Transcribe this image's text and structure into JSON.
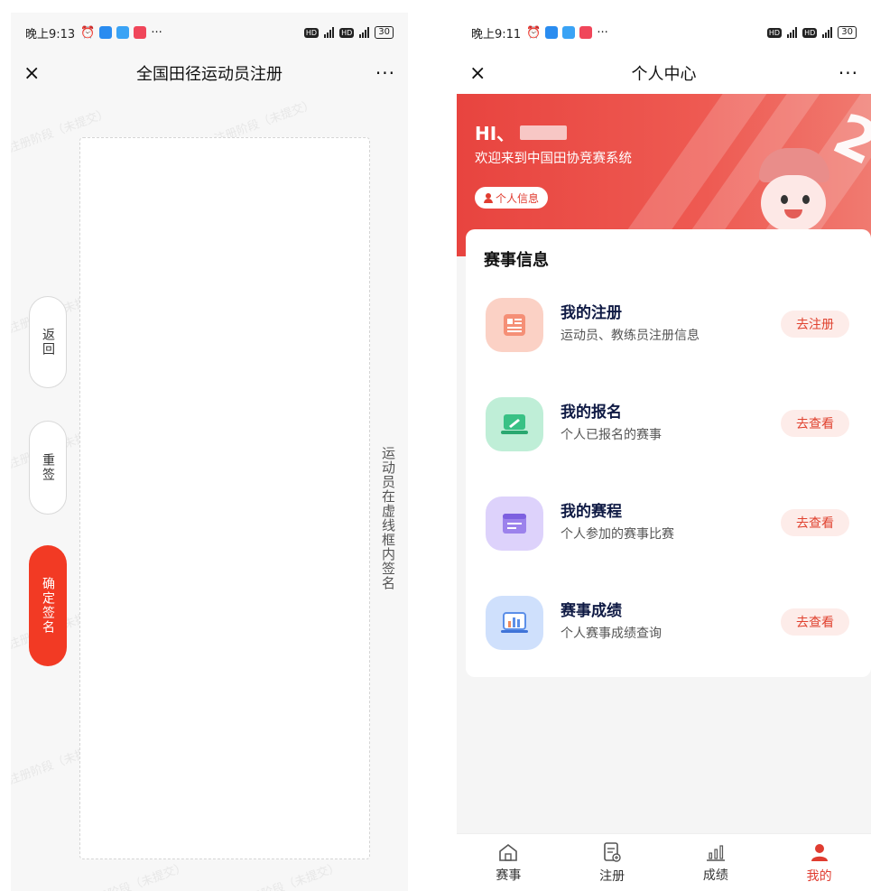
{
  "left_screen": {
    "status_time": "晚上9:13",
    "battery": "30",
    "nav": {
      "close_glyph": "×",
      "title": "全国田径运动员注册",
      "more_glyph": "···"
    },
    "watermark_text": "注册阶段（未提交）",
    "buttons": {
      "back": "返回",
      "resign": "重签",
      "confirm": "确定签名"
    },
    "hint": "运动员在虚线框内签名",
    "accent": "#f23a24"
  },
  "right_screen": {
    "status_time": "晚上9:11",
    "battery": "30",
    "nav": {
      "close_glyph": "×",
      "title": "个人中心",
      "more_glyph": "···"
    },
    "banner": {
      "greeting": "HI、",
      "welcome": "欢迎来到中国田协竞赛系统",
      "info_button": "个人信息",
      "badge": "2"
    },
    "section_title": "赛事信息",
    "items": [
      {
        "title": "我的注册",
        "subtitle": "运动员、教练员注册信息",
        "action": "去注册",
        "icon": "registration-doc-icon",
        "color": "#f7a591"
      },
      {
        "title": "我的报名",
        "subtitle": "个人已报名的赛事",
        "action": "去查看",
        "icon": "laptop-sign-icon",
        "color": "#4fcf98"
      },
      {
        "title": "我的赛程",
        "subtitle": "个人参加的赛事比赛",
        "action": "去查看",
        "icon": "schedule-window-icon",
        "color": "#a890ef"
      },
      {
        "title": "赛事成绩",
        "subtitle": "个人赛事成绩查询",
        "action": "去查看",
        "icon": "results-chart-icon",
        "color": "#6d9df0"
      }
    ],
    "tabs": [
      {
        "label": "赛事",
        "icon": "home-icon"
      },
      {
        "label": "注册",
        "icon": "register-doc-icon"
      },
      {
        "label": "成绩",
        "icon": "bar-chart-icon"
      },
      {
        "label": "我的",
        "icon": "user-icon"
      }
    ],
    "accent": "#e03c30"
  }
}
